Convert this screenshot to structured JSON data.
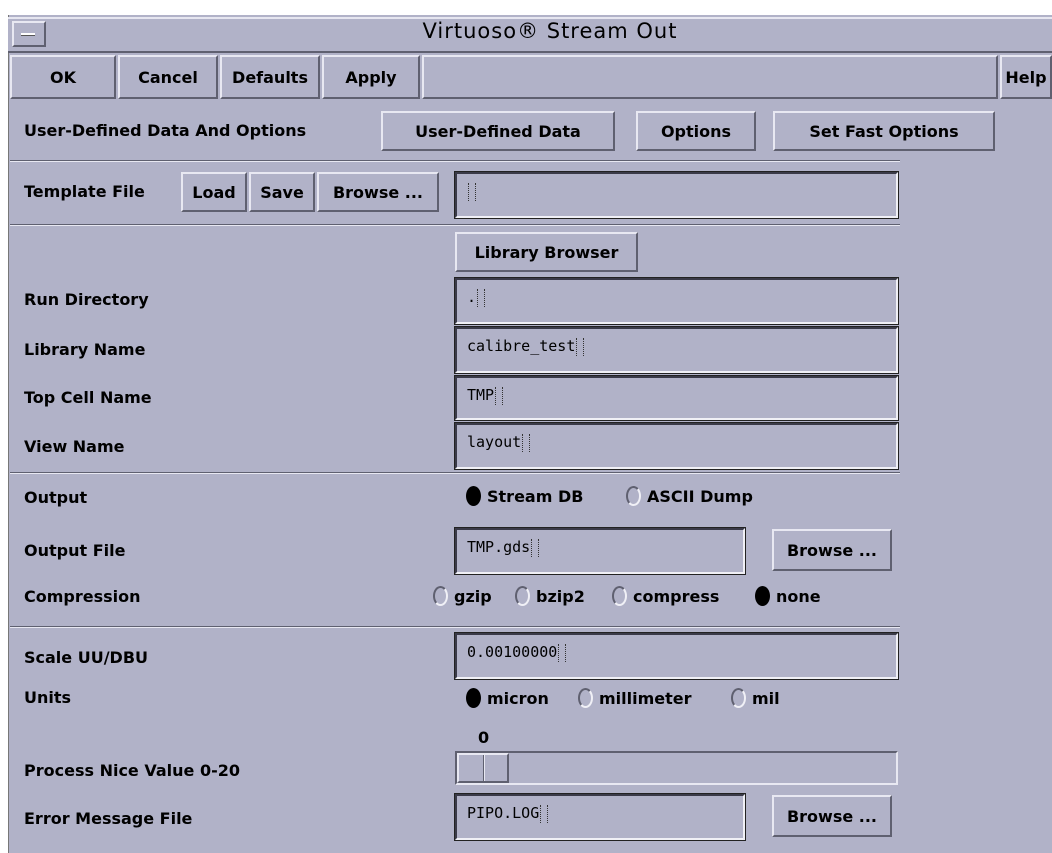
{
  "window": {
    "title": "Virtuoso® Stream Out"
  },
  "toolbar": {
    "ok": "OK",
    "cancel": "Cancel",
    "defaults": "Defaults",
    "apply": "Apply",
    "help": "Help"
  },
  "options_row": {
    "label": "User-Defined Data And Options",
    "user_defined_data": "User-Defined Data",
    "options": "Options",
    "set_fast_options": "Set Fast Options"
  },
  "template": {
    "label": "Template File",
    "load": "Load",
    "save": "Save",
    "browse": "Browse ...",
    "value": ""
  },
  "library_browser": "Library Browser",
  "run_directory": {
    "label": "Run Directory",
    "value": "."
  },
  "library_name": {
    "label": "Library Name",
    "value": "calibre_test"
  },
  "top_cell": {
    "label": "Top Cell Name",
    "value": "TMP"
  },
  "view_name": {
    "label": "View Name",
    "value": "layout"
  },
  "output": {
    "label": "Output",
    "options": [
      "Stream DB",
      "ASCII Dump"
    ],
    "selected": "Stream DB"
  },
  "output_file": {
    "label": "Output File",
    "value": "TMP.gds",
    "browse": "Browse ..."
  },
  "compression": {
    "label": "Compression",
    "options": [
      "gzip",
      "bzip2",
      "compress",
      "none"
    ],
    "selected": "none"
  },
  "scale": {
    "label": "Scale UU/DBU",
    "value": "0.00100000"
  },
  "units": {
    "label": "Units",
    "options": [
      "micron",
      "millimeter",
      "mil"
    ],
    "selected": "micron"
  },
  "process_nice": {
    "label": "Process Nice Value 0-20",
    "value": "0",
    "min": 0,
    "max": 20
  },
  "error_file": {
    "label": "Error Message File",
    "value": "PIPO.LOG",
    "browse": "Browse ..."
  }
}
